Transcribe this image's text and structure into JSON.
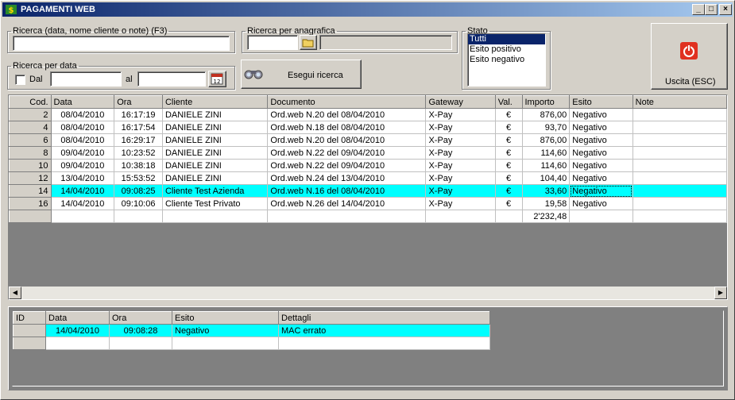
{
  "window": {
    "title": "PAGAMENTI WEB",
    "controls": {
      "minimize": "_",
      "maximize": "□",
      "close": "×"
    }
  },
  "search": {
    "legend": "Ricerca (data, nome cliente o note) (F3)",
    "value": ""
  },
  "anagrafica": {
    "legend": "Ricerca per anagrafica",
    "value": "",
    "display": ""
  },
  "date_search": {
    "legend": "Ricerca per data",
    "dal_label": "Dal",
    "al_label": "al",
    "dal_value": "",
    "al_value": "",
    "calendar_text": "12"
  },
  "run_search": {
    "label": "Esegui ricerca"
  },
  "stato": {
    "legend": "Stato",
    "options": [
      "Tutti",
      "Esito positivo",
      "Esito negativo"
    ],
    "selected": "Tutti"
  },
  "exit": {
    "label": "Uscita (ESC)",
    "icon": "power-icon",
    "icon_color": "#e03020"
  },
  "main_table": {
    "columns": [
      "Cod.",
      "Data",
      "Ora",
      "Cliente",
      "Documento",
      "Gateway",
      "Val.",
      "Importo",
      "Esito",
      "Note"
    ],
    "rows": [
      {
        "cod": "2",
        "data": "08/04/2010",
        "ora": "16:17:19",
        "cliente": "DANIELE ZINI",
        "documento": "Ord.web N.20 del 08/04/2010",
        "gateway": "X-Pay",
        "val": "€",
        "importo": "876,00",
        "esito": "Negativo",
        "note": ""
      },
      {
        "cod": "4",
        "data": "08/04/2010",
        "ora": "16:17:54",
        "cliente": "DANIELE ZINI",
        "documento": "Ord.web N.18 del 08/04/2010",
        "gateway": "X-Pay",
        "val": "€",
        "importo": "93,70",
        "esito": "Negativo",
        "note": ""
      },
      {
        "cod": "6",
        "data": "08/04/2010",
        "ora": "16:29:17",
        "cliente": "DANIELE ZINI",
        "documento": "Ord.web N.20 del 08/04/2010",
        "gateway": "X-Pay",
        "val": "€",
        "importo": "876,00",
        "esito": "Negativo",
        "note": ""
      },
      {
        "cod": "8",
        "data": "09/04/2010",
        "ora": "10:23:52",
        "cliente": "DANIELE ZINI",
        "documento": "Ord.web N.22 del 09/04/2010",
        "gateway": "X-Pay",
        "val": "€",
        "importo": "114,60",
        "esito": "Negativo",
        "note": ""
      },
      {
        "cod": "10",
        "data": "09/04/2010",
        "ora": "10:38:18",
        "cliente": "DANIELE ZINI",
        "documento": "Ord.web N.22 del 09/04/2010",
        "gateway": "X-Pay",
        "val": "€",
        "importo": "114,60",
        "esito": "Negativo",
        "note": ""
      },
      {
        "cod": "12",
        "data": "13/04/2010",
        "ora": "15:53:52",
        "cliente": "DANIELE ZINI",
        "documento": "Ord.web N.24 del 13/04/2010",
        "gateway": "X-Pay",
        "val": "€",
        "importo": "104,40",
        "esito": "Negativo",
        "note": ""
      },
      {
        "cod": "14",
        "data": "14/04/2010",
        "ora": "09:08:25",
        "cliente": "Cliente Test Azienda",
        "documento": "Ord.web N.16 del 08/04/2010",
        "gateway": "X-Pay",
        "val": "€",
        "importo": "33,60",
        "esito": "Negativo",
        "note": "",
        "selected": true
      },
      {
        "cod": "16",
        "data": "14/04/2010",
        "ora": "09:10:06",
        "cliente": "Cliente Test Privato",
        "documento": "Ord.web N.26 del 14/04/2010",
        "gateway": "X-Pay",
        "val": "€",
        "importo": "19,58",
        "esito": "Negativo",
        "note": ""
      }
    ],
    "total": "2'232,48",
    "highlight_color": "#00ffff"
  },
  "detail_table": {
    "columns": [
      "ID",
      "Data",
      "Ora",
      "Esito",
      "Dettagli"
    ],
    "rows": [
      {
        "id": "",
        "data": "14/04/2010",
        "ora": "09:08:28",
        "esito": "Negativo",
        "dettagli": "MAC errato",
        "selected": true
      }
    ]
  }
}
